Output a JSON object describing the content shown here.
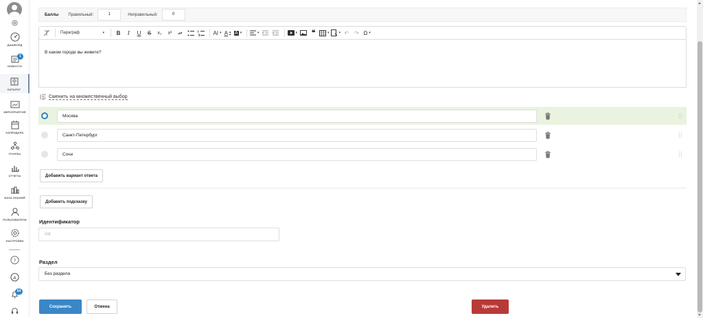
{
  "sidebar": {
    "items": [
      {
        "label": "дашборд",
        "icon": "dashboard-icon"
      },
      {
        "label": "новости",
        "icon": "news-icon",
        "badge": "1"
      },
      {
        "label": "каталог",
        "icon": "catalog-icon",
        "active": true
      },
      {
        "label": "мероприятия",
        "icon": "events-icon"
      },
      {
        "label": "календарь",
        "icon": "calendar-icon"
      },
      {
        "label": "группы",
        "icon": "groups-icon"
      },
      {
        "label": "отчеты",
        "icon": "reports-icon"
      },
      {
        "label": "база знаний",
        "icon": "knowledge-base-icon"
      },
      {
        "label": "пользователи",
        "icon": "users-icon"
      },
      {
        "label": "настройки",
        "icon": "settings-icon"
      }
    ],
    "notifications_badge": "64"
  },
  "score": {
    "title": "Баллы",
    "correct_label": "Правильный:",
    "correct_value": "1",
    "incorrect_label": "Неправильный:",
    "incorrect_value": "0"
  },
  "toolbar": {
    "paragraph_label": "Параграф"
  },
  "editor": {
    "question_text": "В каком городе вы живете?"
  },
  "switch_multiple_choice": "Сменить на множественный выбор",
  "answers": [
    {
      "text": "Москва",
      "correct": true
    },
    {
      "text": "Санкт-Петербург",
      "correct": false
    },
    {
      "text": "Сочи",
      "correct": false
    }
  ],
  "buttons": {
    "add_answer": "Добавить вариант ответа",
    "add_hint": "Добавить подсказку",
    "save": "Сохранить",
    "cancel": "Отмена",
    "delete": "Удалить"
  },
  "identifier": {
    "label": "Идентификатор",
    "placeholder": "cid"
  },
  "section": {
    "label": "Раздел",
    "selected": "Без раздела"
  },
  "colors": {
    "primary": "#3a87c8",
    "danger": "#b83a37",
    "correct_row": "#e9f3df"
  }
}
